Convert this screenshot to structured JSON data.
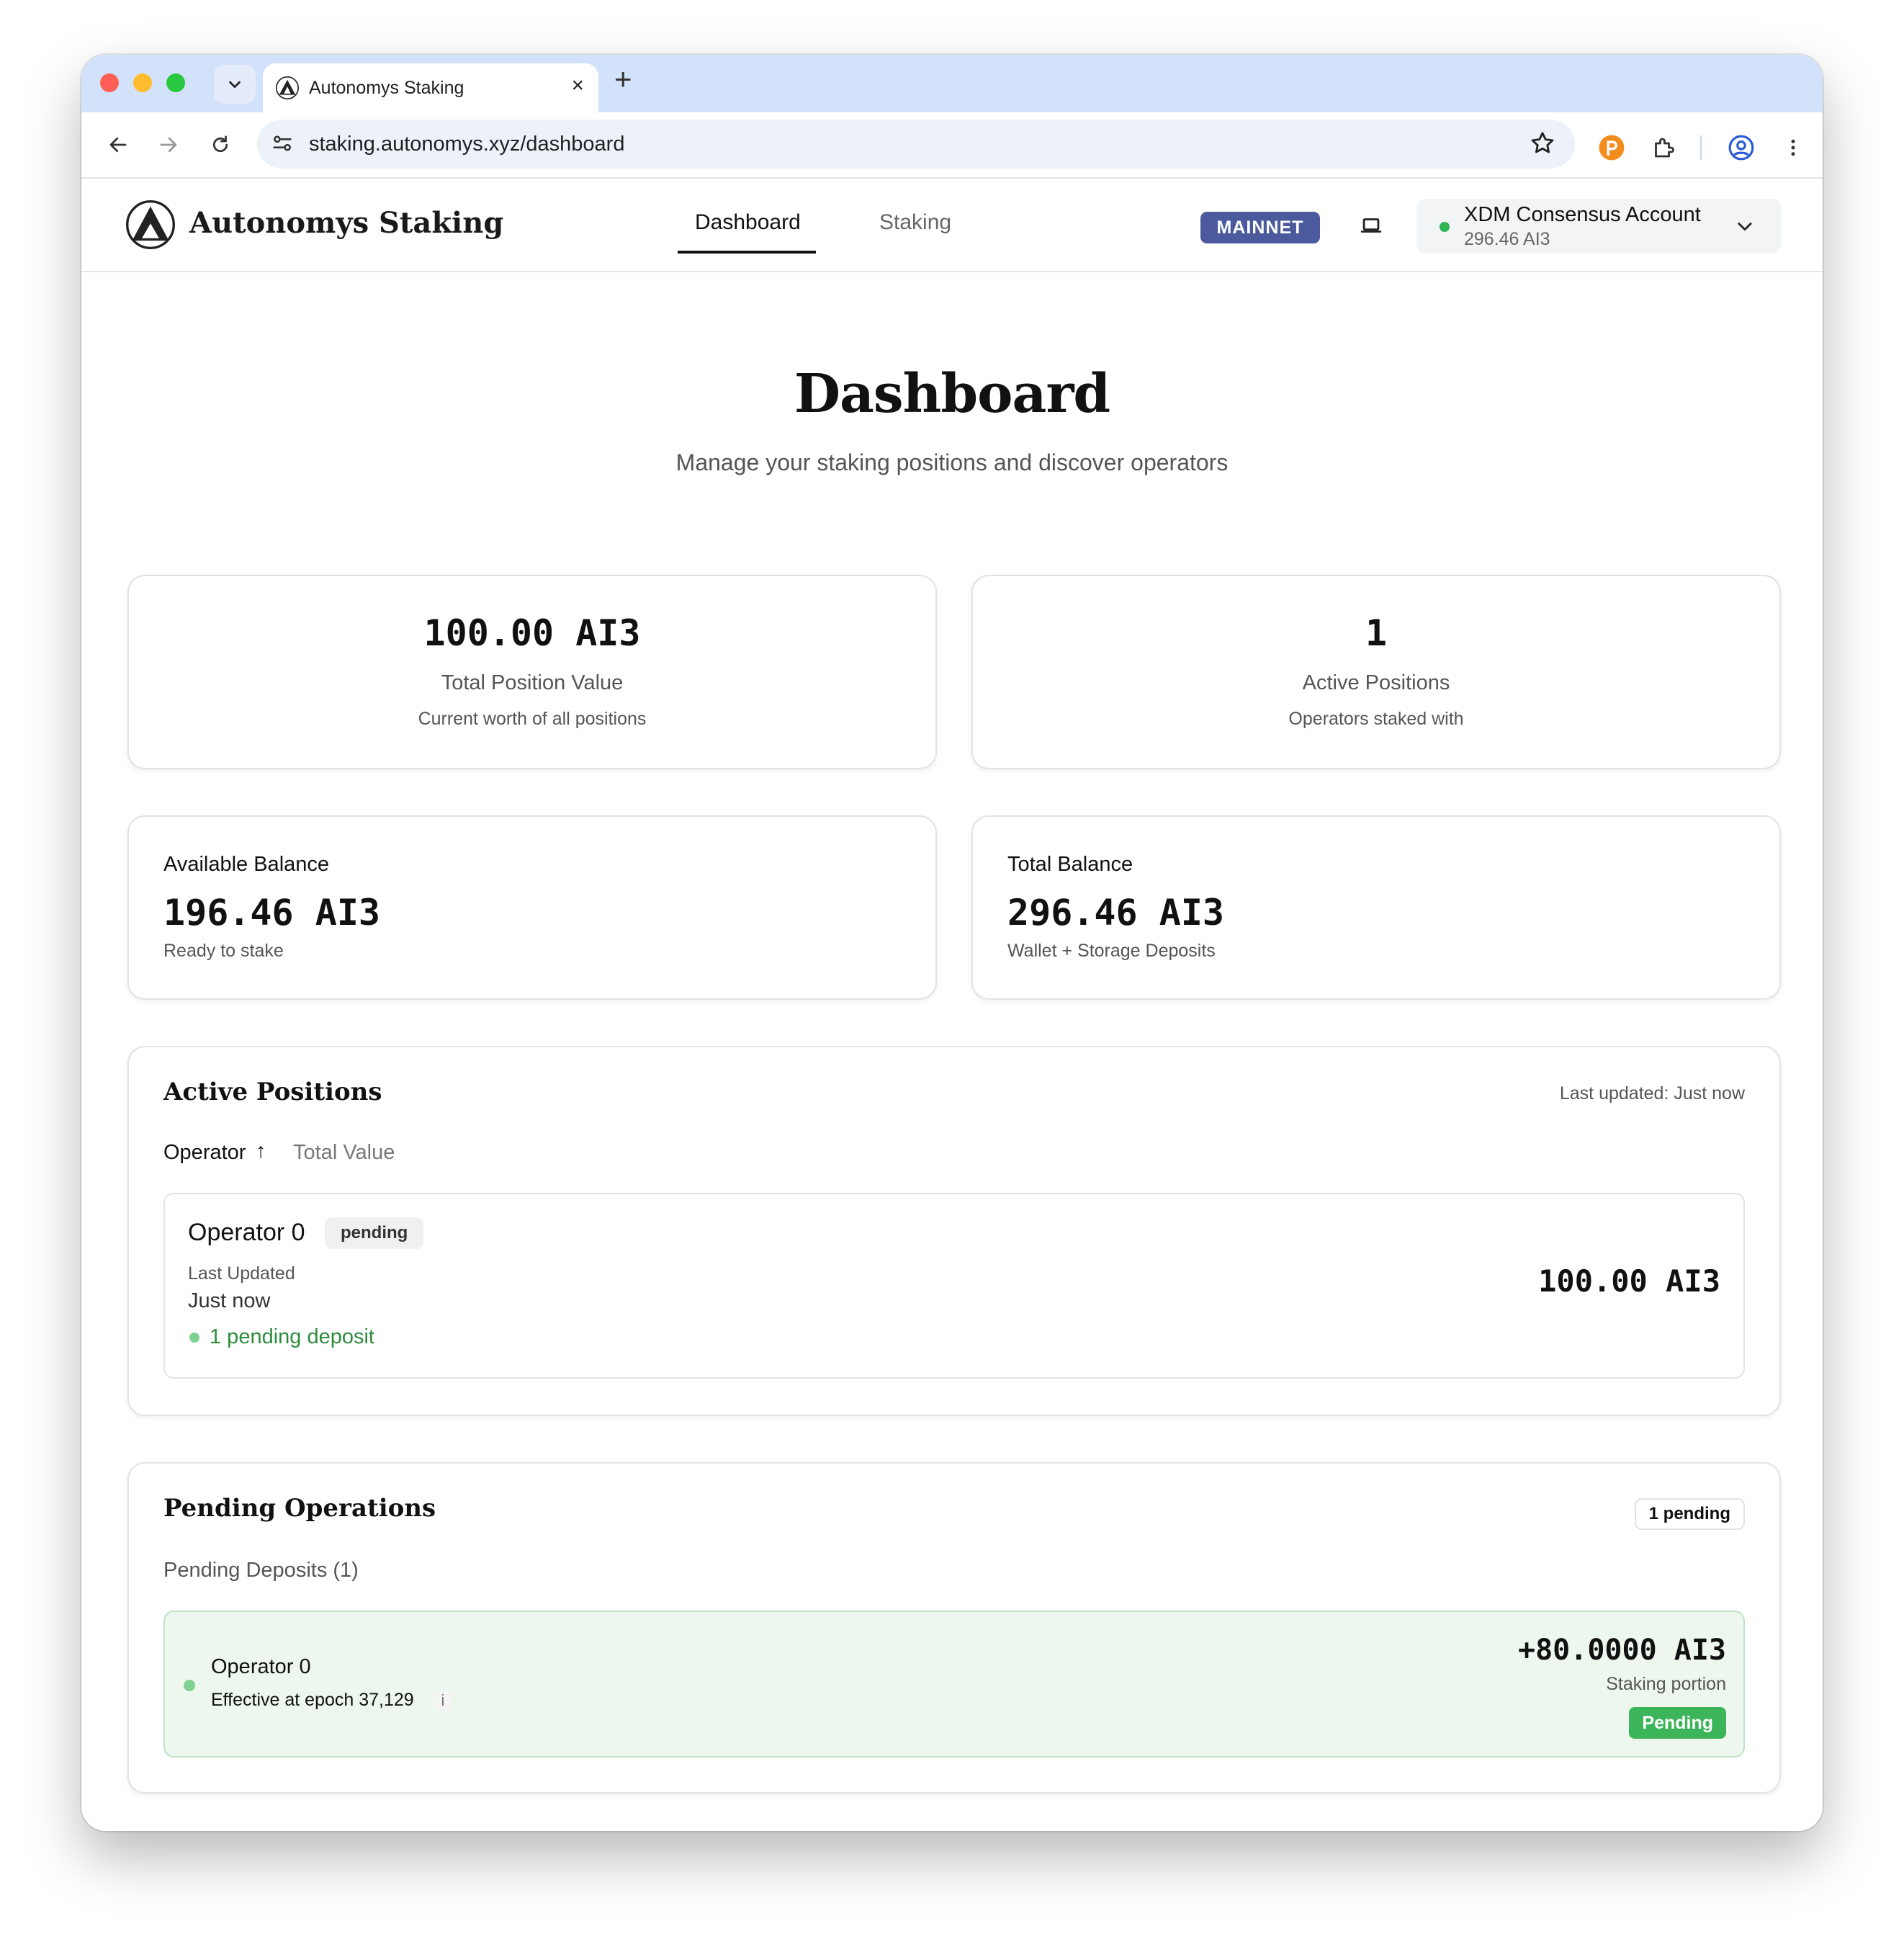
{
  "browser": {
    "tab_title": "Autonomys Staking",
    "tab_close": "×",
    "new_tab": "+",
    "url": "staking.autonomys.xyz/dashboard"
  },
  "header": {
    "brand": "Autonomys Staking",
    "nav": [
      "Dashboard",
      "Staking"
    ],
    "active_nav": "Dashboard",
    "network_badge": "MAINNET",
    "account_name": "XDM Consensus Account",
    "account_balance": "296.46 AI3"
  },
  "hero": {
    "title": "Dashboard",
    "subtitle": "Manage your staking positions and discover operators"
  },
  "stats": [
    {
      "value": "100.00 AI3",
      "label": "Total Position Value",
      "sub": "Current worth of all positions"
    },
    {
      "value": "1",
      "label": "Active Positions",
      "sub": "Operators staked with"
    }
  ],
  "balances": [
    {
      "label": "Available Balance",
      "value": "196.46 AI3",
      "sub": "Ready to stake"
    },
    {
      "label": "Total Balance",
      "value": "296.46 AI3",
      "sub": "Wallet + Storage Deposits"
    }
  ],
  "active_positions": {
    "title": "Active Positions",
    "last_updated": "Last updated: Just now",
    "sort_operator": "Operator",
    "sort_arrow": "↑",
    "sort_value": "Total Value",
    "rows": [
      {
        "operator": "Operator 0",
        "badge": "pending",
        "last_updated_label": "Last Updated",
        "last_updated_value": "Just now",
        "pending_note": "1 pending deposit",
        "value": "100.00 AI3"
      }
    ]
  },
  "pending_operations": {
    "title": "Pending Operations",
    "count_badge": "1 pending",
    "deposits_heading": "Pending Deposits (1)",
    "deposits": [
      {
        "operator": "Operator 0",
        "epoch": "Effective at epoch 37,129",
        "info": "i",
        "amount": "+80.0000 AI3",
        "portion": "Staking portion",
        "status": "Pending"
      }
    ]
  },
  "colors": {
    "network_badge": "#4a5a9c",
    "success_green": "#3cb55a",
    "pending_row_bg": "#edf7ee"
  }
}
